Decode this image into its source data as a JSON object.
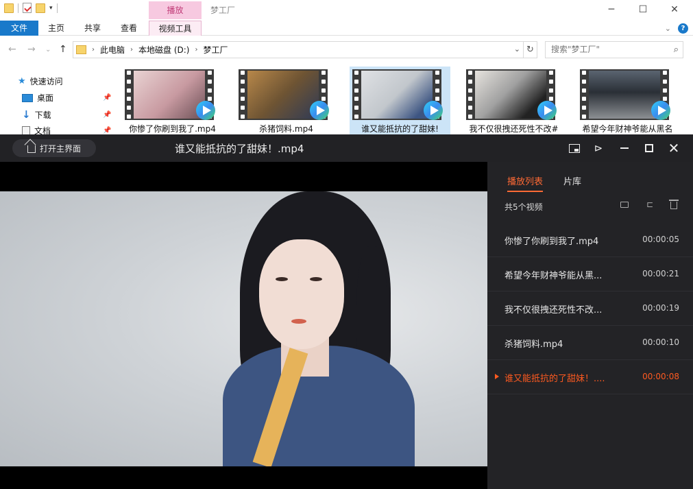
{
  "explorer": {
    "context_tab": "播放",
    "window_title": "梦工厂",
    "ribbon_tabs": [
      "文件",
      "主页",
      "共享",
      "查看",
      "视频工具"
    ],
    "breadcrumb": [
      "此电脑",
      "本地磁盘 (D:)",
      "梦工厂"
    ],
    "search_placeholder": "搜索\"梦工厂\"",
    "nav": [
      {
        "label": "快速访问"
      },
      {
        "label": "桌面"
      },
      {
        "label": "下载"
      },
      {
        "label": "文档"
      }
    ],
    "files": [
      {
        "name": "你惨了你刷到我了.mp4"
      },
      {
        "name": "杀猪饲料.mp4"
      },
      {
        "name": "谁又能抵抗的了甜妹!"
      },
      {
        "name": "我不仅很拽还死性不改#"
      },
      {
        "name": "希望今年财神爷能从黑名"
      }
    ]
  },
  "player": {
    "home_label": "打开主界面",
    "title": "谁又能抵抗的了甜妹！.mp4",
    "tabs": [
      "播放列表",
      "片库"
    ],
    "count_label": "共5个视频",
    "playlist": [
      {
        "name": "你惨了你刷到我了.mp4",
        "duration": "00:00:05",
        "current": false
      },
      {
        "name": "希望今年财神爷能从黑...",
        "duration": "00:00:21",
        "current": false
      },
      {
        "name": "我不仅很拽还死性不改...",
        "duration": "00:00:19",
        "current": false
      },
      {
        "name": "杀猪饲料.mp4",
        "duration": "00:00:10",
        "current": false
      },
      {
        "name": "谁又能抵抗的了甜妹！....",
        "duration": "00:00:08",
        "current": true
      }
    ],
    "accent_color": "#ff5a20"
  }
}
